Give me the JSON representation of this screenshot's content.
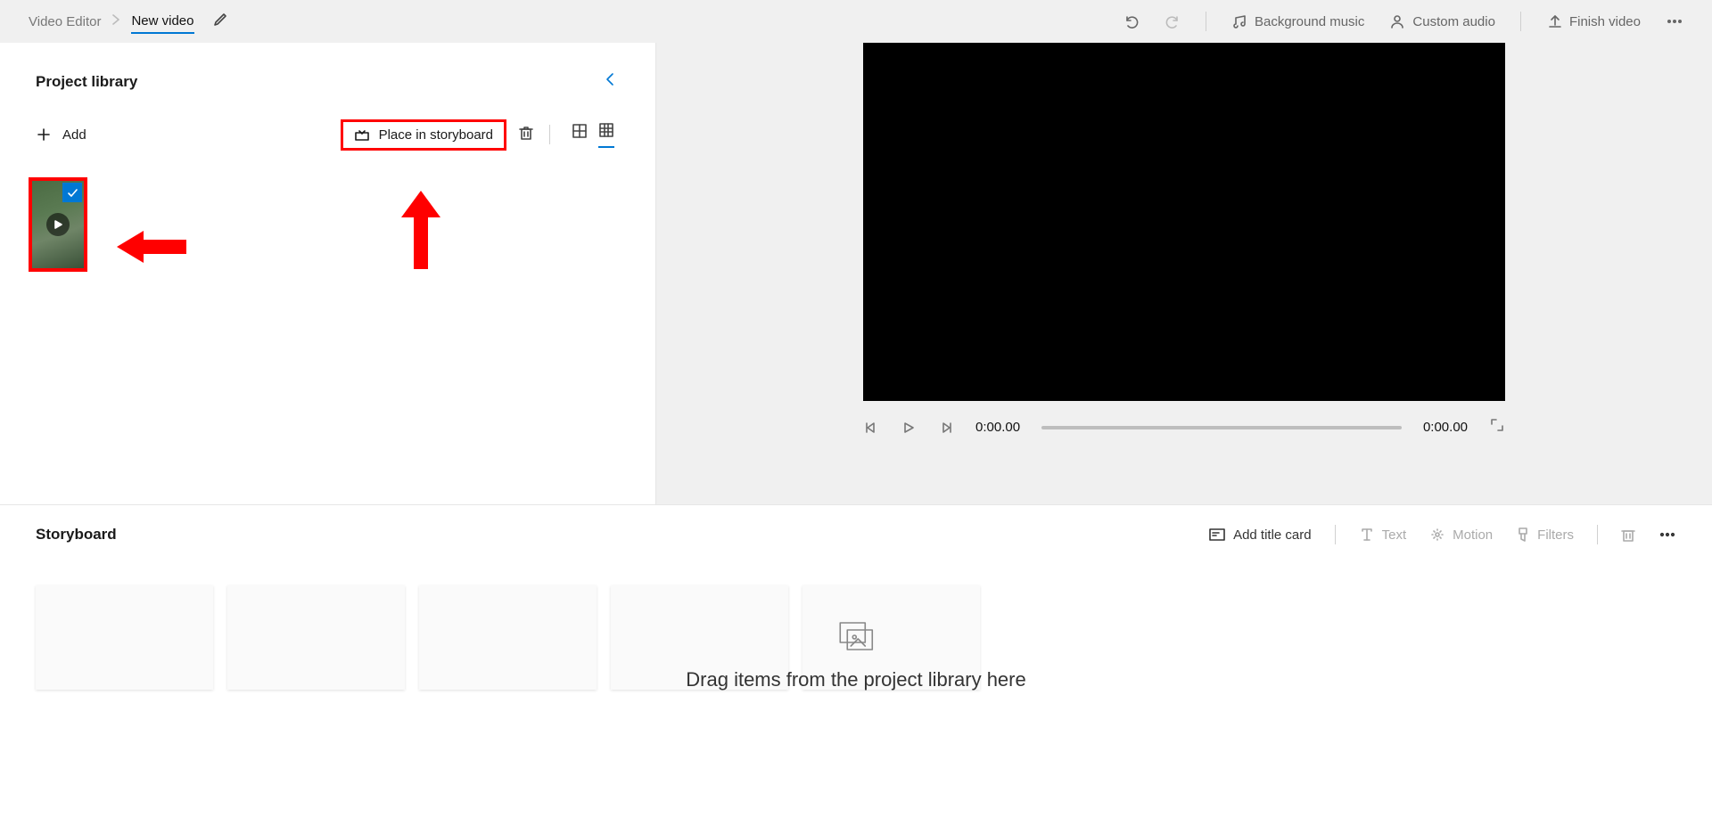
{
  "breadcrumb": {
    "root": "Video Editor",
    "title": "New video"
  },
  "top": {
    "bg_music": "Background music",
    "custom_audio": "Custom audio",
    "finish": "Finish video"
  },
  "library": {
    "heading": "Project library",
    "add": "Add",
    "place": "Place in storyboard"
  },
  "preview": {
    "current": "0:00.00",
    "total": "0:00.00"
  },
  "storyboard": {
    "heading": "Storyboard",
    "add_title": "Add title card",
    "text": "Text",
    "motion": "Motion",
    "filters": "Filters",
    "hint": "Drag items from the project library here"
  }
}
